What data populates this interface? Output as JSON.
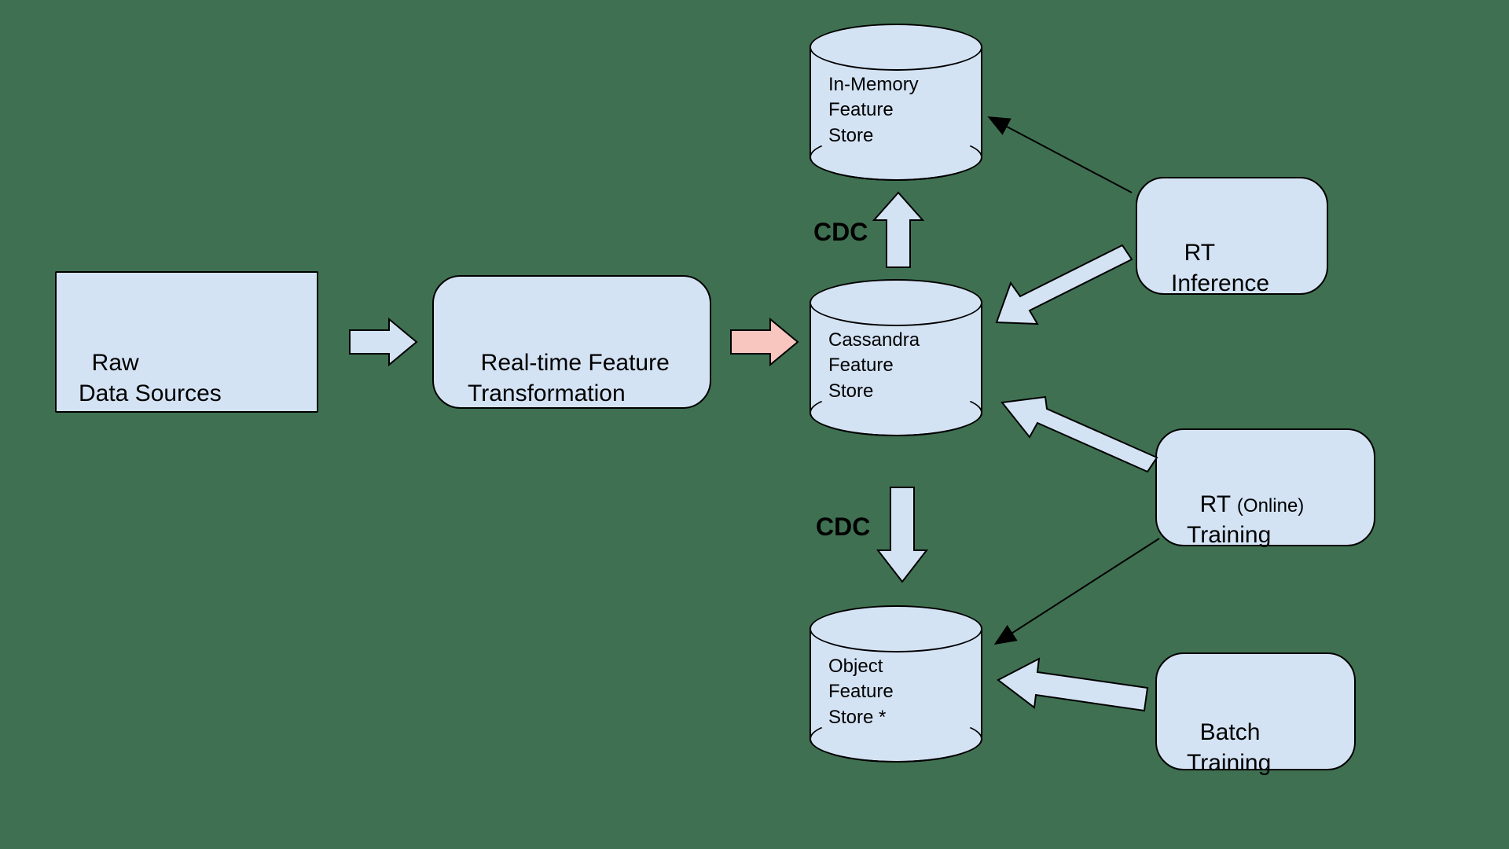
{
  "nodes": {
    "raw": {
      "line1": "Raw",
      "line2": "Data Sources"
    },
    "rtft": {
      "line1": "Real-time Feature",
      "line2": "Transformation"
    },
    "rtinf": {
      "line1": "RT",
      "line2": "Inference"
    },
    "rtonl": {
      "prefix": "RT ",
      "paren": "(Online)",
      "line2": "Training"
    },
    "batch": {
      "line1": "Batch",
      "line2": "Training"
    }
  },
  "stores": {
    "inmem": {
      "l1": "In-Memory",
      "l2": "Feature",
      "l3": "Store"
    },
    "cass": {
      "l1": "Cassandra",
      "l2": "Feature",
      "l3": "Store"
    },
    "obj": {
      "l1": "Object",
      "l2": "Feature",
      "l3": "Store *"
    }
  },
  "labels": {
    "cdc": "CDC"
  },
  "colors": {
    "bg": "#3f7052",
    "fill": "#d4e3f4",
    "arrowPink": "#f9c5bf",
    "arrowBlue": "#d4e3f4"
  }
}
